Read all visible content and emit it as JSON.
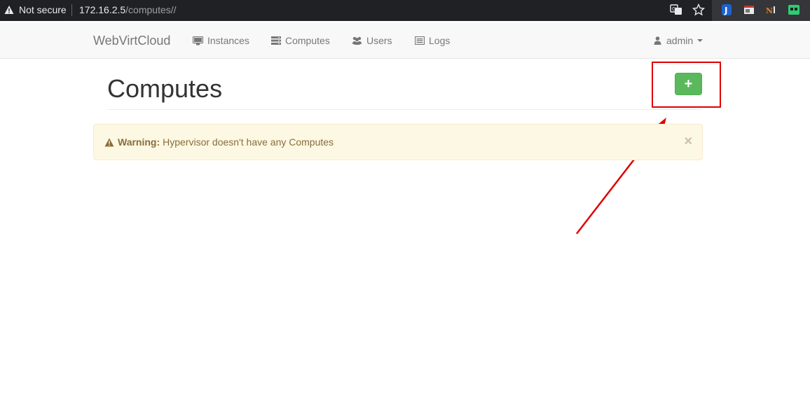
{
  "browser": {
    "security_label": "Not secure",
    "url_host": "172.16.2.5",
    "url_path": "/computes//"
  },
  "navbar": {
    "brand": "WebVirtCloud",
    "items": [
      {
        "label": "Instances",
        "icon": "monitor-icon"
      },
      {
        "label": "Computes",
        "icon": "server-icon"
      },
      {
        "label": "Users",
        "icon": "users-icon"
      },
      {
        "label": "Logs",
        "icon": "list-icon"
      }
    ],
    "user": "admin"
  },
  "page": {
    "title": "Computes",
    "add_button_icon": "plus-icon",
    "add_button_text": "+"
  },
  "alert": {
    "strong": "Warning:",
    "message": "Hypervisor doesn't have any Computes",
    "close": "×"
  },
  "colors": {
    "success": "#5cb85c",
    "annotation": "#e00000",
    "warning_bg": "#fcf8e3",
    "warning_text": "#8a6d3b"
  }
}
